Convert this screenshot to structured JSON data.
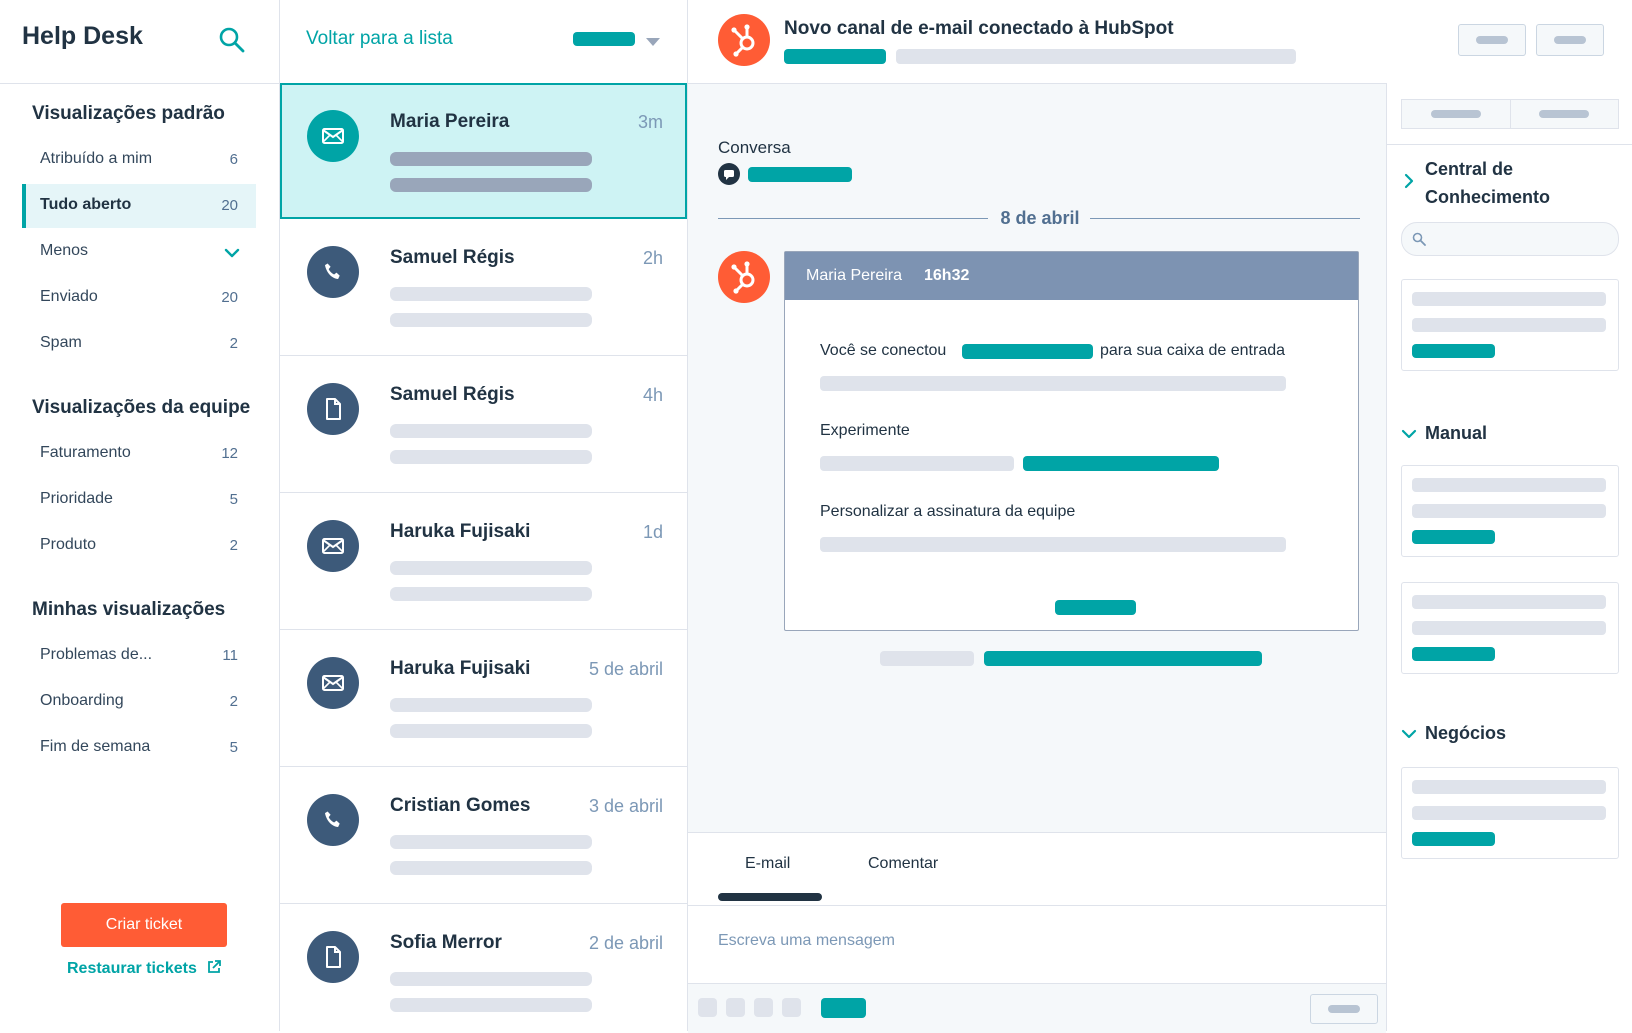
{
  "colors": {
    "accent": "#00a4a6",
    "brand": "#ff5c35",
    "dark": "#213343",
    "avatar": "#3d5a7a"
  },
  "sidebar": {
    "title": "Help Desk",
    "search_icon": "search-icon",
    "default_views": {
      "heading": "Visualizações padrão",
      "items": [
        {
          "label": "Atribuído a mim",
          "count": "6"
        },
        {
          "label": "Tudo aberto",
          "count": "20",
          "active": true
        },
        {
          "label": "Menos",
          "icon": "chevron-down-icon"
        },
        {
          "label": "Enviado",
          "count": "20"
        },
        {
          "label": "Spam",
          "count": "2"
        }
      ]
    },
    "team_views": {
      "heading": "Visualizações da equipe",
      "items": [
        {
          "label": "Faturamento",
          "count": "12"
        },
        {
          "label": "Prioridade",
          "count": "5"
        },
        {
          "label": "Produto",
          "count": "2"
        }
      ]
    },
    "my_views": {
      "heading": "Minhas visualizações",
      "items": [
        {
          "label": "Problemas de...",
          "count": "11"
        },
        {
          "label": "Onboarding",
          "count": "2"
        },
        {
          "label": "Fim de semana",
          "count": "5"
        }
      ]
    },
    "create_button": "Criar ticket",
    "restore_link": "Restaurar tickets"
  },
  "list": {
    "back_label": "Voltar para a lista",
    "items": [
      {
        "name": "Maria Pereira",
        "time": "3m",
        "icon": "email-icon",
        "selected": true
      },
      {
        "name": "Samuel Régis",
        "time": "2h",
        "icon": "phone-icon"
      },
      {
        "name": "Samuel Régis",
        "time": "4h",
        "icon": "document-icon"
      },
      {
        "name": "Haruka Fujisaki",
        "time": "1d",
        "icon": "email-icon"
      },
      {
        "name": "Haruka Fujisaki",
        "time": "5 de abril",
        "icon": "email-icon"
      },
      {
        "name": "Cristian Gomes",
        "time": "3 de abril",
        "icon": "phone-icon"
      },
      {
        "name": "Sofia Merror",
        "time": "2 de abril",
        "icon": "document-icon"
      }
    ]
  },
  "main": {
    "title": "Novo canal de e-mail conectado à HubSpot",
    "conversation_label": "Conversa",
    "date_divider": "8 de abril",
    "message": {
      "sender": "Maria Pereira",
      "time": "16h32",
      "line1_before": "Você se conectou",
      "line1_after": "para sua caixa de entrada",
      "section2": "Experimente",
      "section3": "Personalizar a assinatura da equipe"
    },
    "composer": {
      "tab_email": "E-mail",
      "tab_comment": "Comentar",
      "placeholder": "Escreva uma mensagem"
    }
  },
  "right_panel": {
    "knowledge_heading_1": "Central de",
    "knowledge_heading_2": "Conhecimento",
    "manual_heading": "Manual",
    "deals_heading": "Negócios"
  }
}
